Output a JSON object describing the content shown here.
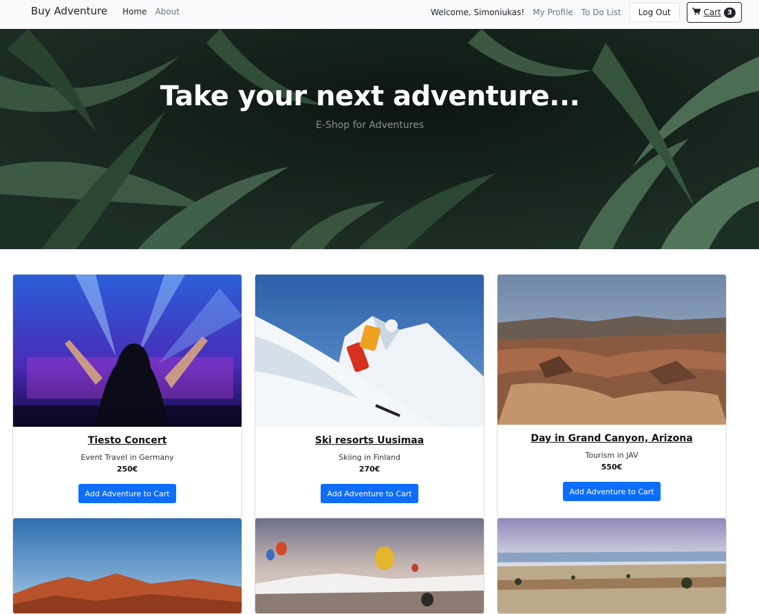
{
  "nav": {
    "brand": "Buy Adventure",
    "links": [
      "Home",
      "About"
    ],
    "welcome": "Welcome, Simoniukas!",
    "profile": "My Profile",
    "todo": "To Do List",
    "logout": "Log Out",
    "cart_label": "Cart",
    "cart_count": "3"
  },
  "hero": {
    "title": "Take your next adventure...",
    "subtitle": "E-Shop for Adventures"
  },
  "products": [
    {
      "title": "Tiesto Concert",
      "subtitle": "Event Travel in Germany",
      "price": "250€",
      "button": "Add Adventure to Cart"
    },
    {
      "title": "Ski resorts Uusimaa",
      "subtitle": "Skiing in Finland",
      "price": "270€",
      "button": "Add Adventure to Cart"
    },
    {
      "title": "Day in Grand Canyon, Arizona",
      "subtitle": "Tourism in JAV",
      "price": "550€",
      "button": "Add Adventure to Cart"
    }
  ],
  "icons": {
    "cart": "shopping-cart-icon"
  },
  "colors": {
    "primary": "#0d6efd",
    "navbar_bg": "#f8f9fa"
  }
}
